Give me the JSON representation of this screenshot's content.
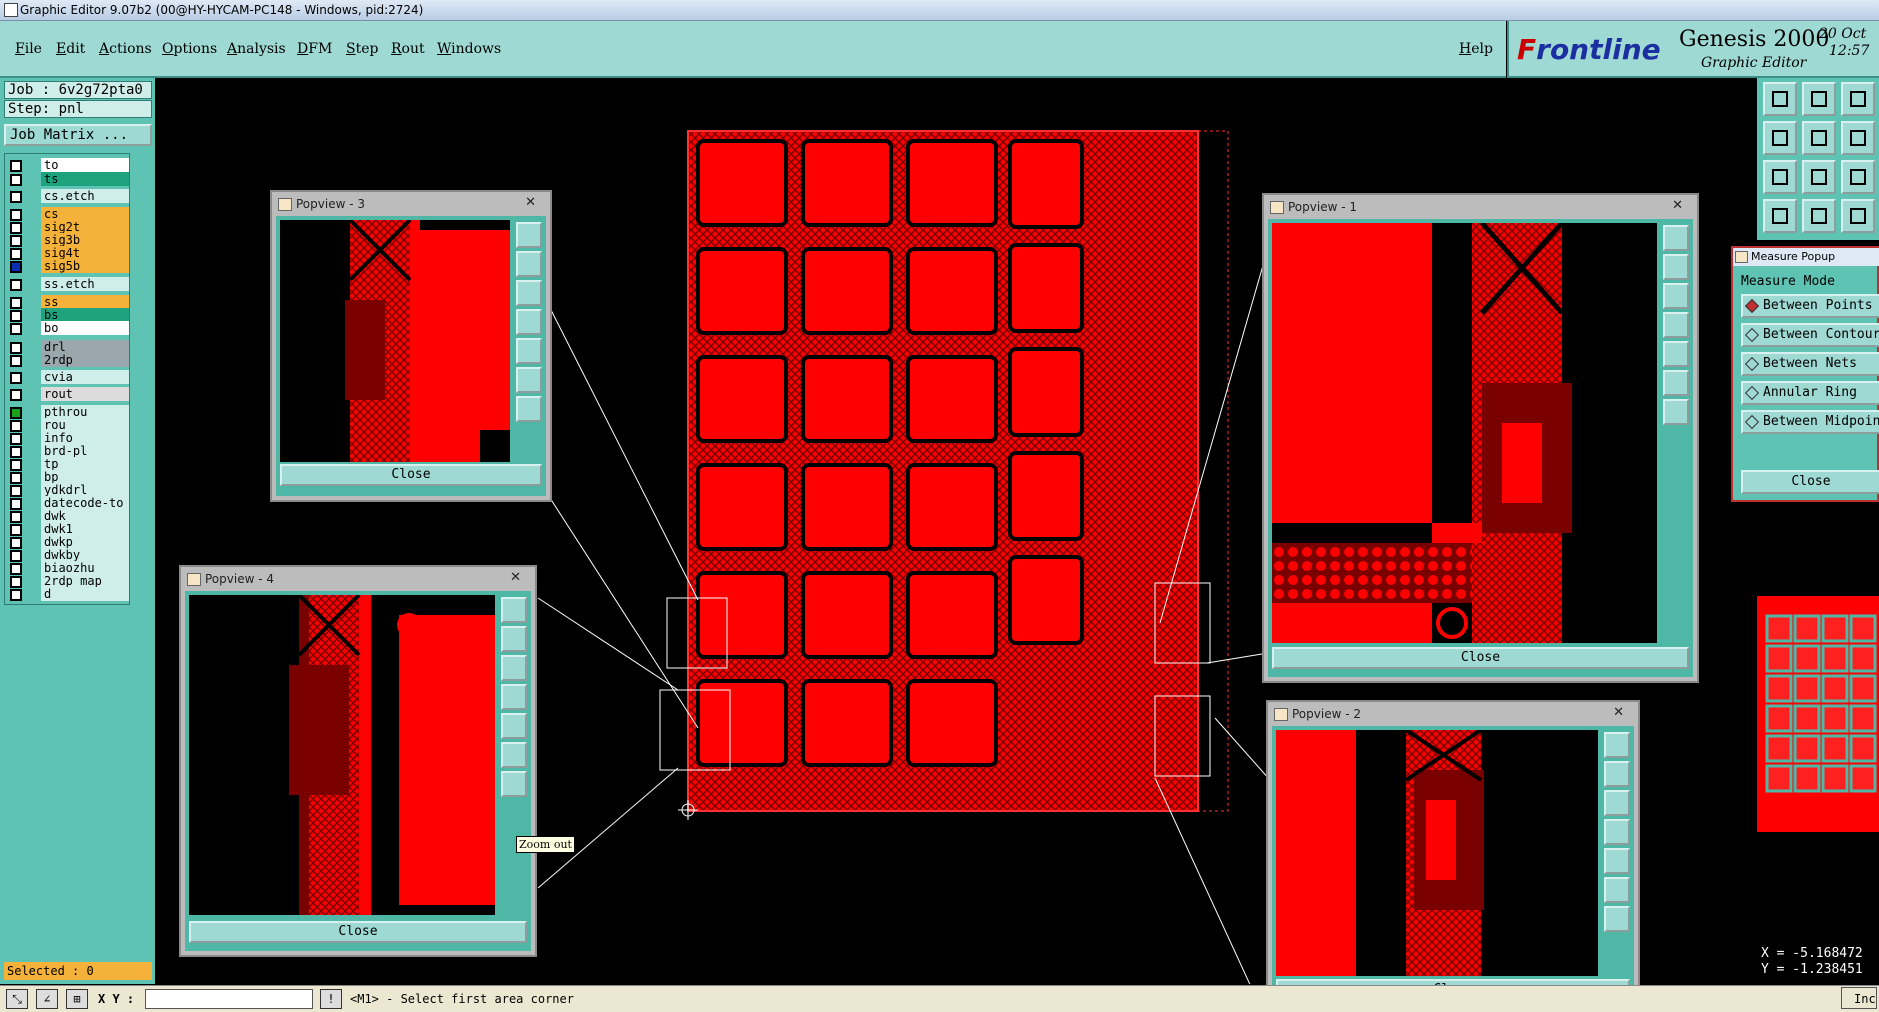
{
  "window": {
    "title": "Graphic Editor 9.07b2 (00@HY-HYCAM-PC148 - Windows, pid:2724)"
  },
  "menu": {
    "items": [
      "File",
      "Edit",
      "Actions",
      "Options",
      "Analysis",
      "DFM",
      "Step",
      "Rout",
      "Windows"
    ],
    "help": "Help"
  },
  "brand": {
    "logo_f": "F",
    "logo_rest": "rontline",
    "product": "Genesis 2000",
    "subtitle": "Graphic Editor",
    "date": "20 Oct",
    "time": "12:57"
  },
  "left": {
    "job": "Job : 6v2g72pta0",
    "step": "Step: pnl",
    "job_matrix": "Job Matrix ...",
    "layers": [
      {
        "name": "to",
        "color": "#ffffff",
        "sw": ""
      },
      {
        "name": "ts",
        "color": "#1ea37e",
        "sw": ""
      },
      {
        "name": "cs.etch",
        "color": "#cfeee9",
        "sw": ""
      },
      {
        "name": "cs",
        "color": "#f5b23a",
        "sw": ""
      },
      {
        "name": "sig2t",
        "color": "#f5b23a",
        "sw": ""
      },
      {
        "name": "sig3b",
        "color": "#f5b23a",
        "sw": ""
      },
      {
        "name": "sig4t",
        "color": "#f5b23a",
        "sw": ""
      },
      {
        "name": "sig5b",
        "color": "#f5b23a",
        "sw": "#0a2fb0"
      },
      {
        "name": "ss.etch",
        "color": "#cfeee9",
        "sw": ""
      },
      {
        "name": "ss",
        "color": "#f5b23a",
        "sw": ""
      },
      {
        "name": "bs",
        "color": "#1ea37e",
        "sw": ""
      },
      {
        "name": "bo",
        "color": "#ffffff",
        "sw": ""
      },
      {
        "name": "drl",
        "color": "#9aa7ad",
        "sw": ""
      },
      {
        "name": "2rdp",
        "color": "#9aa7ad",
        "sw": ""
      },
      {
        "name": "cvia",
        "color": "#cfeee9",
        "sw": ""
      },
      {
        "name": "rout",
        "color": "#dcdcdc",
        "sw": ""
      },
      {
        "name": "pthrou",
        "color": "#cfeee9",
        "sw": "#1aa31a"
      },
      {
        "name": "rou",
        "color": "#cfeee9",
        "sw": ""
      },
      {
        "name": "info",
        "color": "#cfeee9",
        "sw": ""
      },
      {
        "name": "brd-pl",
        "color": "#cfeee9",
        "sw": ""
      },
      {
        "name": "tp",
        "color": "#cfeee9",
        "sw": ""
      },
      {
        "name": "bp",
        "color": "#cfeee9",
        "sw": ""
      },
      {
        "name": "ydkdrl",
        "color": "#cfeee9",
        "sw": ""
      },
      {
        "name": "datecode-to",
        "color": "#cfeee9",
        "sw": ""
      },
      {
        "name": "dwk",
        "color": "#cfeee9",
        "sw": ""
      },
      {
        "name": "dwk1",
        "color": "#cfeee9",
        "sw": ""
      },
      {
        "name": "dwkp",
        "color": "#cfeee9",
        "sw": ""
      },
      {
        "name": "dwkby",
        "color": "#cfeee9",
        "sw": ""
      },
      {
        "name": "biaozhu",
        "color": "#cfeee9",
        "sw": ""
      },
      {
        "name": "2rdp_map",
        "color": "#cfeee9",
        "sw": ""
      },
      {
        "name": "d",
        "color": "#cfeee9",
        "sw": ""
      }
    ],
    "selected": "Selected : 0"
  },
  "bottom": {
    "xy_label": "X Y :",
    "xy_value": "",
    "prompt": "<M1> - Select first area corner",
    "right_label": "Inc"
  },
  "popviews": [
    {
      "title": "Popview - 3",
      "close": "Close"
    },
    {
      "title": "Popview - 4",
      "close": "Close"
    },
    {
      "title": "Popview - 1",
      "close": "Close"
    },
    {
      "title": "Popview - 2",
      "close": "Close"
    }
  ],
  "tooltip": "Zoom out",
  "measure": {
    "title": "Measure Popup",
    "mode_label": "Measure Mode",
    "options": [
      "Between Points",
      "Between Contours",
      "Between Nets",
      "Annular Ring",
      "Between Midpoints"
    ],
    "close": "Close"
  },
  "coords": {
    "x": "X = -5.168472",
    "y": "Y = -1.238451"
  },
  "tool_icons": [
    "page-up-icon",
    "page-down-icon",
    "home-icon",
    "page-left-icon",
    "page-right-icon",
    "fit-icon",
    "zoom-in-icon",
    "zoom-fit-icon",
    "scale-icon",
    "measure-icon",
    "grid-icon",
    "snap-icon"
  ],
  "colors": {
    "board": "#ff0000",
    "panel_bg": "#5fc3b3",
    "menu_bg": "#9fd9d3",
    "canvas": "#000000"
  }
}
